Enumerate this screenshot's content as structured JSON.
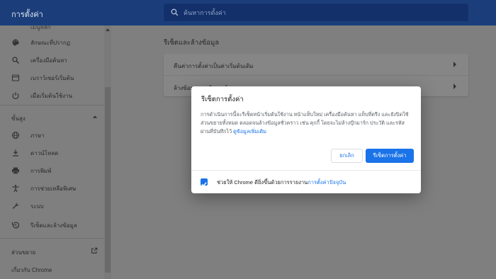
{
  "app": {
    "title": "การตั้งค่า"
  },
  "search": {
    "placeholder": "ค้นหาการตั้งค่า",
    "value": ""
  },
  "sidebar": {
    "partial_top_label": "เมนูหลัก",
    "items": [
      {
        "label": "ลักษณะที่ปรากฏ",
        "icon": "palette-icon"
      },
      {
        "label": "เครื่องมือค้นหา",
        "icon": "search-icon"
      },
      {
        "label": "เบราว์เซอร์เริ่มต้น",
        "icon": "browser-icon"
      },
      {
        "label": "เมื่อเริ่มต้นใช้งาน",
        "icon": "power-icon"
      }
    ],
    "advanced_title": "ขั้นสูง",
    "advanced_items": [
      {
        "label": "ภาษา",
        "icon": "globe-icon"
      },
      {
        "label": "ดาวน์โหลด",
        "icon": "download-icon"
      },
      {
        "label": "การพิมพ์",
        "icon": "printer-icon"
      },
      {
        "label": "การช่วยเหลือพิเศษ",
        "icon": "accessibility-icon"
      },
      {
        "label": "ระบบ",
        "icon": "wrench-icon"
      },
      {
        "label": "รีเซ็ตและล้างข้อมูล",
        "icon": "restore-icon"
      }
    ],
    "extensions_label": "ส่วนขยาย",
    "about_label": "เกี่ยวกับ Chrome"
  },
  "main": {
    "heading": "รีเซ็ตและล้างข้อมูล",
    "rows": [
      {
        "label": "คืนค่าการตั้งค่าเป็นค่าเริ่มต้นเดิม"
      },
      {
        "label": "ล้างข้อมูลคอมพิวเตอร์"
      }
    ]
  },
  "dialog": {
    "title": "รีเซ็ตการตั้งค่า",
    "body": "การดำเนินการนี้จะรีเซ็ตหน้าเริ่มต้นใช้งาน หน้าแท็บใหม่ เครื่องมือค้นหา แท็บที่ตรึง และยังปิดใช้ส่วนขยายทั้งหมด ตลอดจนล้างข้อมูลชั่วคราว เช่น คุกกี้ โดยจะไม่ล้างบุ๊กมาร์ก ประวัติ และรหัสผ่านที่บันทึกไว้",
    "learn_more": "ดูข้อมูลเพิ่มเติม",
    "cancel_label": "ยกเลิก",
    "reset_label": "รีเซ็ตการตั้งค่า",
    "checkbox_text": "ช่วยให้ Chrome ดียิ่งขึ้นด้วยการรายงาน",
    "checkbox_link": "การตั้งค่าปัจจุบัน",
    "checkbox_checked": true
  },
  "colors": {
    "topbar": "#1b3e7a",
    "accent": "#1a73e8",
    "scrim": "#7f7f7f"
  }
}
